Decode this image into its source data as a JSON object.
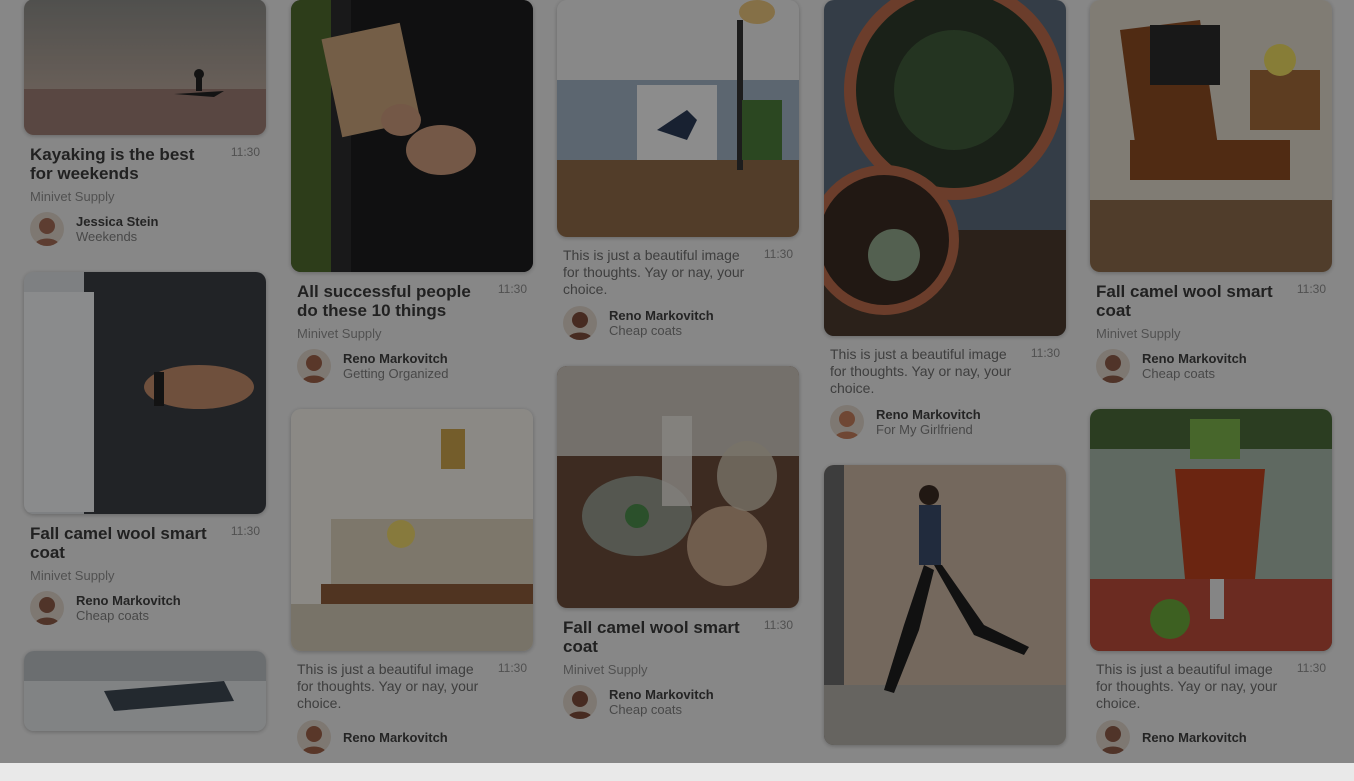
{
  "columns": [
    [
      {
        "img": "kayak",
        "h": 136,
        "offset": -1,
        "title": "Kayaking is the best for weekends",
        "time": "11:30",
        "sub": "Minivet Supply",
        "author": "Jessica Stein",
        "board": "Weekends",
        "avatar": "#a06a55"
      },
      {
        "img": "wrist",
        "h": 242,
        "title": "Fall camel wool smart coat",
        "time": "11:30",
        "sub": "Minivet Supply",
        "author": "Reno Markovitch",
        "board": "Cheap coats",
        "avatar": "#8a5a48"
      },
      {
        "img": "desk",
        "h": 80,
        "title": "",
        "time": "",
        "sub": "",
        "author": "",
        "board": "",
        "avatar": "#8a5a48"
      }
    ],
    [
      {
        "img": "tablet",
        "h": 272,
        "title": "All successful people do these 10 things",
        "time": "11:30",
        "sub": "Minivet Supply",
        "author": "Reno Markovitch",
        "board": "Getting Organized",
        "avatar": "#9a5f48"
      },
      {
        "img": "living",
        "h": 242,
        "desc": "This is just a beautiful image for thoughts. Yay or nay, your choice.",
        "time": "11:30",
        "author": "Reno Markovitch",
        "board": "",
        "avatar": "#9a5f48"
      }
    ],
    [
      {
        "img": "sofa",
        "h": 237,
        "desc": "This is just a beautiful image for thoughts. Yay or nay, your choice.",
        "time": "11:30",
        "author": "Reno Markovitch",
        "board": "Cheap coats",
        "avatar": "#7a4a3a"
      },
      {
        "img": "glass",
        "h": 242,
        "title": "Fall camel wool smart coat",
        "time": "11:30",
        "sub": "Minivet Supply",
        "author": "Reno Markovitch",
        "board": "Cheap coats",
        "avatar": "#7a4a3a"
      }
    ],
    [
      {
        "img": "succulent",
        "h": 336,
        "desc": "This is just a beautiful image for thoughts. Yay or nay, your choice.",
        "time": "11:30",
        "author": "Reno Markovitch",
        "board": "For My Girlfriend",
        "avatar": "#c07a5a"
      },
      {
        "img": "runner",
        "h": 280,
        "title": "",
        "time": "",
        "author": "",
        "board": "",
        "avatar": "#c07a5a"
      }
    ],
    [
      {
        "img": "chair",
        "h": 272,
        "title": "Fall camel wool smart coat",
        "time": "11:30",
        "sub": "Minivet Supply",
        "author": "Reno Markovitch",
        "board": "Cheap coats",
        "avatar": "#8a5a48"
      },
      {
        "img": "drink",
        "h": 242,
        "desc": "This is just a beautiful image for thoughts. Yay or nay, your choice.",
        "time": "11:30",
        "author": "Reno Markovitch",
        "board": "",
        "avatar": "#8a5a48"
      }
    ]
  ],
  "overlay": {
    "dimmed": true
  }
}
